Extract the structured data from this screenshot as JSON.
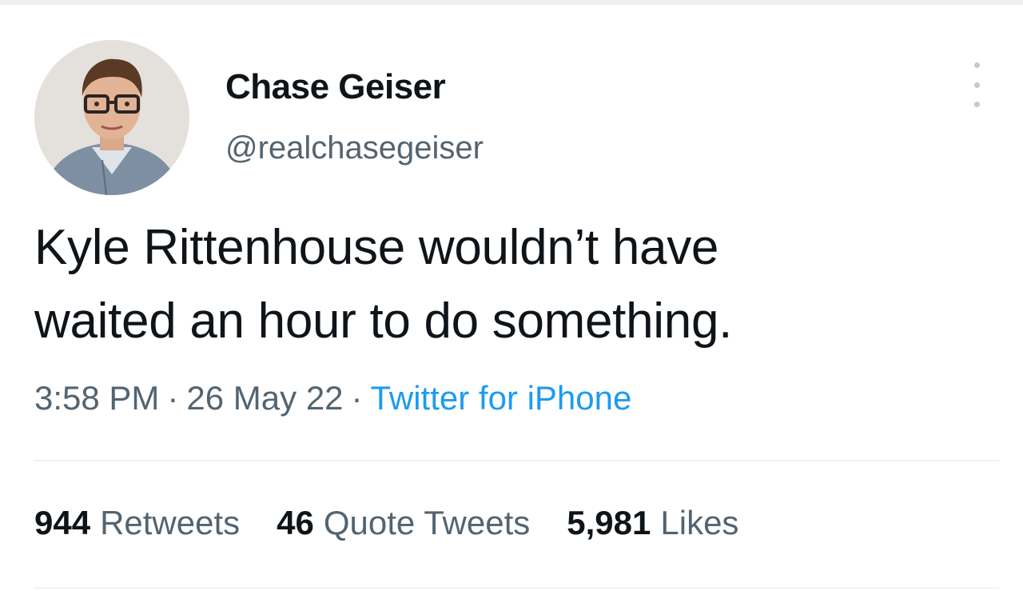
{
  "author": {
    "display_name": "Chase Geiser",
    "handle": "@realchasegeiser"
  },
  "tweet": {
    "text_line1": "Kyle Rittenhouse wouldn’t have",
    "text_line2": "waited an hour to do something."
  },
  "meta": {
    "time": "3:58 PM",
    "separator": "·",
    "date": "26 May 22",
    "source": "Twitter for iPhone"
  },
  "stats": {
    "retweets_count": "944",
    "retweets_label": "Retweets",
    "quotes_count": "46",
    "quotes_label": "Quote Tweets",
    "likes_count": "5,981",
    "likes_label": "Likes"
  },
  "icons": {
    "more": "more-vertical-icon"
  },
  "colors": {
    "text_primary": "#0f1419",
    "text_secondary": "#536471",
    "link": "#1d9bf0",
    "divider": "#eff3f4"
  }
}
